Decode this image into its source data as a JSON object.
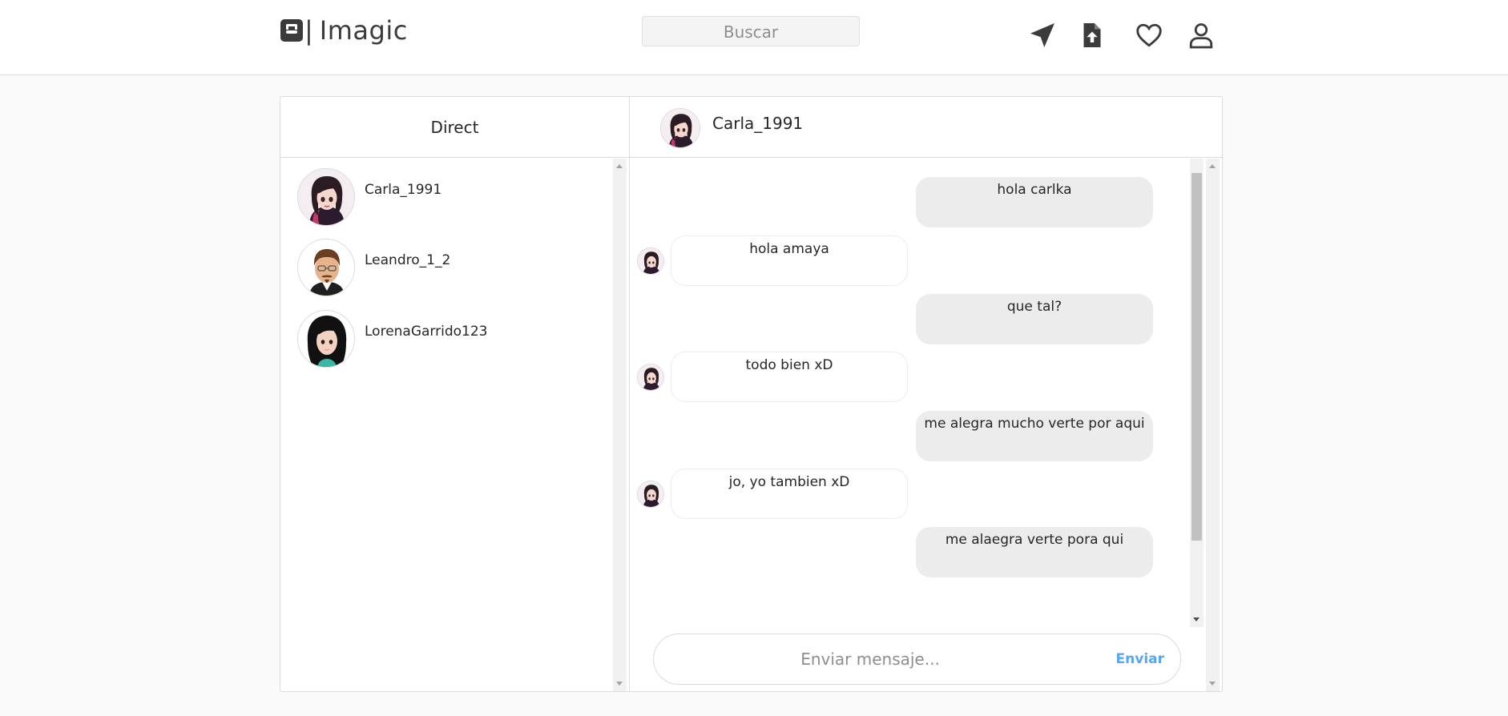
{
  "app": {
    "brand": "Imagic",
    "brand_separator": "|",
    "logo_icon": "blogger-icon"
  },
  "header": {
    "search": {
      "placeholder": "Buscar"
    },
    "nav": [
      {
        "name": "direct-icon"
      },
      {
        "name": "upload-icon"
      },
      {
        "name": "heart-icon"
      },
      {
        "name": "profile-icon"
      }
    ]
  },
  "inbox": {
    "title": "Direct",
    "contacts": [
      {
        "username": "Carla_1991"
      },
      {
        "username": "Leandro_1_2"
      },
      {
        "username": "LorenaGarrido123"
      }
    ]
  },
  "chat": {
    "username": "Carla_1991",
    "messages": [
      {
        "from": "me",
        "text": "hola carlka"
      },
      {
        "from": "them",
        "text": "hola amaya"
      },
      {
        "from": "me",
        "text": "que tal?"
      },
      {
        "from": "them",
        "text": "todo bien xD"
      },
      {
        "from": "me",
        "text": "me alegra mucho verte por aqui"
      },
      {
        "from": "them",
        "text": "jo, yo tambien xD"
      },
      {
        "from": "me",
        "text": "me alaegra verte pora qui"
      }
    ],
    "composer": {
      "placeholder": "Enviar mensaje...",
      "send_label": "Enviar"
    }
  },
  "colors": {
    "page_bg": "#fafafa",
    "border": "#dbdbdb",
    "outgoing_bubble": "#ececec",
    "send_link": "#58a6f2",
    "icon": "#3b3b3b"
  }
}
